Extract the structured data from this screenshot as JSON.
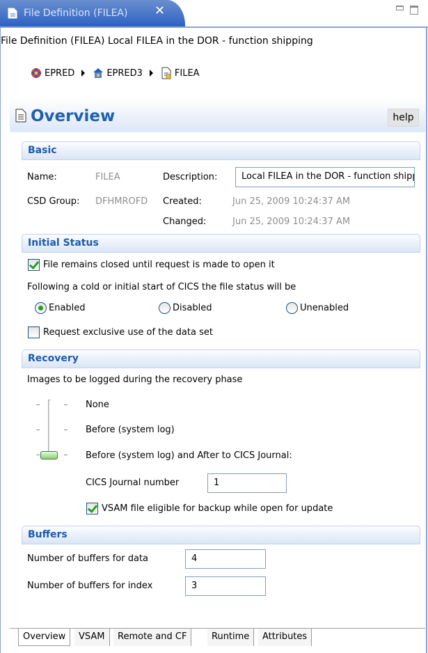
{
  "editor_tab": {
    "title": "File Definition (FILEA)",
    "close_glyph": "✕"
  },
  "headline": "File Definition (FILEA) Local FILEA in the DOR - function shipping",
  "breadcrumb": [
    {
      "label": "EPRED",
      "icon": "cics-plex-icon"
    },
    {
      "label": "EPRED3",
      "icon": "region-icon"
    },
    {
      "label": "FILEA",
      "icon": "file-definition-icon"
    }
  ],
  "overview": {
    "title": "Overview",
    "help_label": "help"
  },
  "basic": {
    "title": "Basic",
    "name_label": "Name:",
    "name_value": "FILEA",
    "description_label": "Description:",
    "description_value": "Local FILEA in the DOR - function shipping",
    "csd_group_label": "CSD Group:",
    "csd_group_value": "DFHMROFD",
    "created_label": "Created:",
    "created_value": "Jun 25, 2009 10:24:37 AM",
    "changed_label": "Changed:",
    "changed_value": "Jun 25, 2009 10:24:37 AM"
  },
  "initial_status": {
    "title": "Initial Status",
    "closed_checkbox_label": "File remains closed until request is made to open it",
    "closed_checked": true,
    "following_text": "Following a cold or initial start of CICS the file status will be",
    "radios": [
      {
        "label": "Enabled",
        "selected": true
      },
      {
        "label": "Disabled",
        "selected": false
      },
      {
        "label": "Unenabled",
        "selected": false
      }
    ],
    "exclusive_checkbox_label": "Request exclusive use of the data set",
    "exclusive_checked": false
  },
  "recovery": {
    "title": "Recovery",
    "intro": "Images to be logged during the recovery phase",
    "levels": [
      "None",
      "Before (system log)",
      "Before (system log) and After to CICS Journal:"
    ],
    "selected_level": 2,
    "journal_label": "CICS Journal number",
    "journal_value": "1",
    "vsam_backup_label": "VSAM file eligible for backup while open for update",
    "vsam_backup_checked": true
  },
  "buffers": {
    "title": "Buffers",
    "data_label": "Number of buffers for data",
    "data_value": "4",
    "index_label": "Number of buffers for index",
    "index_value": "3"
  },
  "bottom_tabs": [
    "Overview",
    "VSAM",
    "Remote and CF",
    "Runtime",
    "Attributes"
  ],
  "active_bottom_tab": "Overview",
  "colors": {
    "section_title": "#1b5cad",
    "overview_title": "#1e61b0",
    "tab_blue": "#2d62c4",
    "check_green": "#21a121"
  }
}
